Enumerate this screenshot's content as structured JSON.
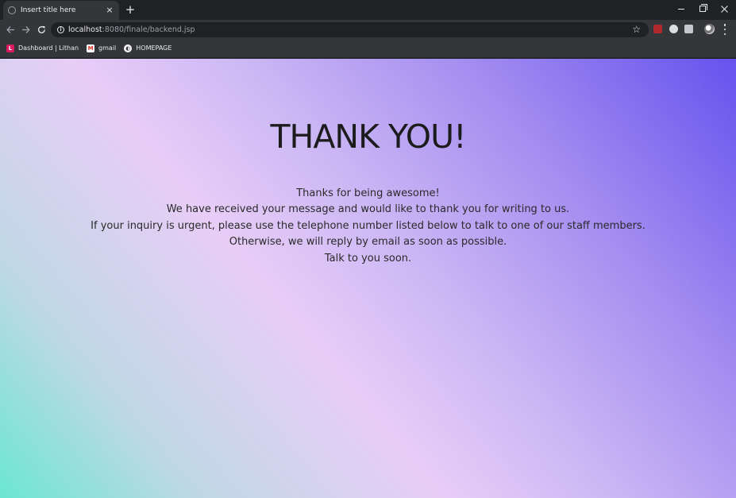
{
  "browser": {
    "tab": {
      "title": "Insert title here",
      "close_glyph": "×"
    },
    "new_tab_glyph": "+",
    "window_controls": [
      "minimize",
      "maximize",
      "close"
    ],
    "nav": {
      "back_icon": "arrow-left-icon",
      "forward_icon": "arrow-right-icon",
      "reload_icon": "reload-icon"
    },
    "url": {
      "host": "localhost",
      "rest": ":8080/finale/backend.jsp"
    },
    "bookmark_star_glyph": "☆",
    "bookmarks": [
      {
        "label": "Dashboard | Lithan",
        "favicon": "L"
      },
      {
        "label": "gmail",
        "favicon": "M"
      },
      {
        "label": "HOMEPAGE",
        "favicon": "◐"
      }
    ]
  },
  "page": {
    "heading": "THANK YOU!",
    "message_lines": [
      "Thanks for being awesome!",
      "We have received your message and would like to thank you for writing to us.",
      "If your inquiry is urgent, please use the telephone number listed below to talk to one of our staff members.",
      "Otherwise, we will reply by email as soon as possible.",
      "Talk to you soon."
    ]
  },
  "colors": {
    "gradient_start": "#6be7d1",
    "gradient_mid": "#e8cdf7",
    "gradient_end": "#6652ee",
    "chrome_dark": "#202124",
    "chrome_toolbar": "#35363a"
  }
}
